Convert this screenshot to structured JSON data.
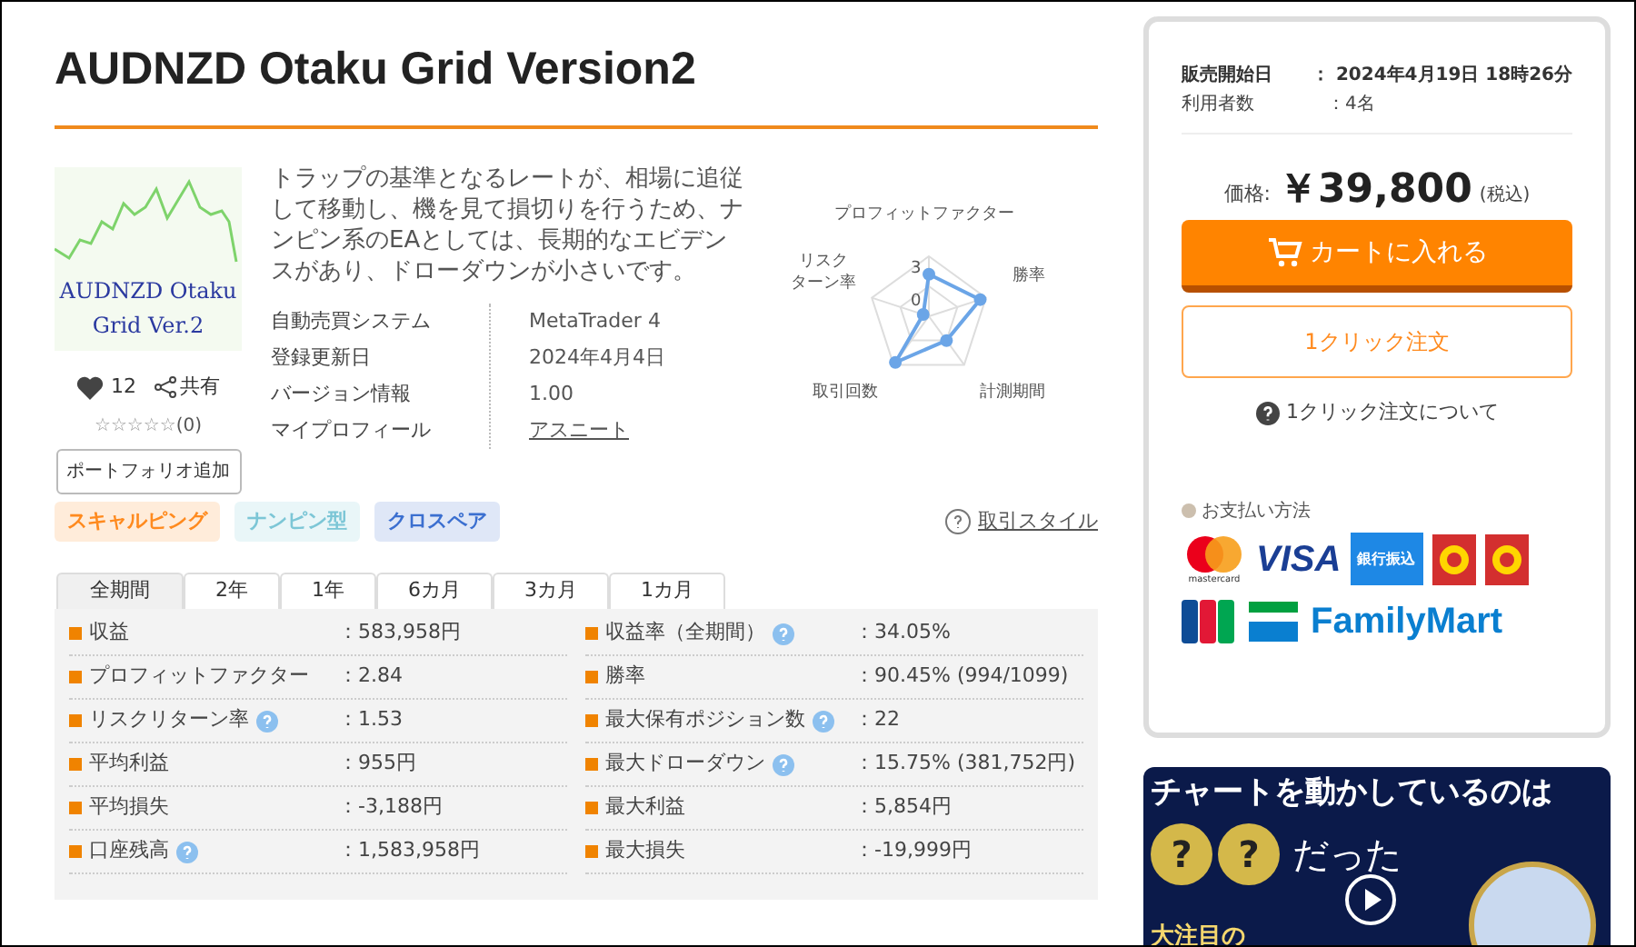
{
  "title": "AUDNZD Otaku Grid Version2",
  "product_image": {
    "caption_lines": [
      "AUDNZD Otaku",
      "Grid Ver.2"
    ]
  },
  "description": "トラップの基準となるレートが、相場に追従して移動し、機を見て損切りを行うため、ナンピン系のEAとしては、長期的なエビデンスがあり、ドローダウンが小さいです。",
  "likes": "12",
  "share": "共有",
  "stars": 0,
  "rating_count": "(0)",
  "portfolio_button": "ポートフォリオ追加",
  "info": [
    {
      "label": "自動売買システム",
      "value": "MetaTrader 4",
      "kind": "text"
    },
    {
      "label": "登録更新日",
      "value": "2024年4月4日",
      "kind": "text"
    },
    {
      "label": "バージョン情報",
      "value": "1.00",
      "kind": "text"
    },
    {
      "label": "マイプロフィール",
      "value": "アスニート",
      "kind": "link"
    }
  ],
  "radar": {
    "axes": [
      {
        "lines": [
          "プロフィットファクター"
        ]
      },
      {
        "lines": [
          "リスク",
          "ターン率"
        ]
      },
      {
        "lines": [
          "勝率"
        ]
      },
      {
        "lines": [
          "取引回数"
        ]
      },
      {
        "lines": [
          "計測期間"
        ]
      }
    ],
    "tick_labels": [
      "3",
      "0"
    ]
  },
  "tags": [
    {
      "label": "スキャルピング",
      "color": "#ff8a1e"
    },
    {
      "label": "ナンピン型",
      "color": "#7cc6d6"
    },
    {
      "label": "クロスペア",
      "color": "#3b6fd0"
    }
  ],
  "trade_style_link": "取引スタイル",
  "tabs": [
    {
      "label": "全期間",
      "selected": true
    },
    {
      "label": "2年",
      "selected": false
    },
    {
      "label": "1年",
      "selected": false
    },
    {
      "label": "6カ月",
      "selected": false
    },
    {
      "label": "3カ月",
      "selected": false
    },
    {
      "label": "1カ月",
      "selected": false
    }
  ],
  "stats": [
    [
      {
        "label": "収益",
        "help": false,
        "value": "：583,958円"
      },
      {
        "label": "収益率（全期間）",
        "help": true,
        "value": "：34.05%"
      }
    ],
    [
      {
        "label": "プロフィットファクター",
        "help": false,
        "value": "：2.84"
      },
      {
        "label": "勝率",
        "help": false,
        "value": "：90.45% (994/1099)"
      }
    ],
    [
      {
        "label": "リスクリターン率",
        "help": true,
        "value": "：1.53"
      },
      {
        "label": "最大保有ポジション数",
        "help": true,
        "value": "：22"
      }
    ],
    [
      {
        "label": "平均利益",
        "help": false,
        "value": "：955円"
      },
      {
        "label": "最大ドローダウン",
        "help": true,
        "value": "：15.75% (381,752円)"
      }
    ],
    [
      {
        "label": "平均損失",
        "help": false,
        "value": "：-3,188円"
      },
      {
        "label": "最大利益",
        "help": false,
        "value": "：5,854円"
      }
    ],
    [
      {
        "label": "口座残高",
        "help": true,
        "value": "：1,583,958円"
      },
      {
        "label": "最大損失",
        "help": false,
        "value": "：-19,999円"
      }
    ]
  ],
  "sale_info": [
    {
      "label": "販売開始日",
      "value": "：  2024年4月19日 18時26分",
      "bold": true
    },
    {
      "label": "利用者数",
      "value": "：4名",
      "bold": false
    }
  ],
  "price": {
    "label": "価格:",
    "amount": "￥39,800",
    "tax": "(税込)"
  },
  "cart_button": "カートに入れる",
  "one_click_button": "1クリック注文",
  "one_click_help": "1クリック注文について",
  "payment": {
    "title": "お支払い方法",
    "mastercard": "mastercard",
    "visa": "VISA",
    "bank": "銀行振込",
    "familymart": "FamilyMart"
  },
  "banner": {
    "headline": "チャートを動かしているのは",
    "marks": [
      "?",
      "?"
    ],
    "tail": "だった",
    "footer": "大注目の"
  }
}
